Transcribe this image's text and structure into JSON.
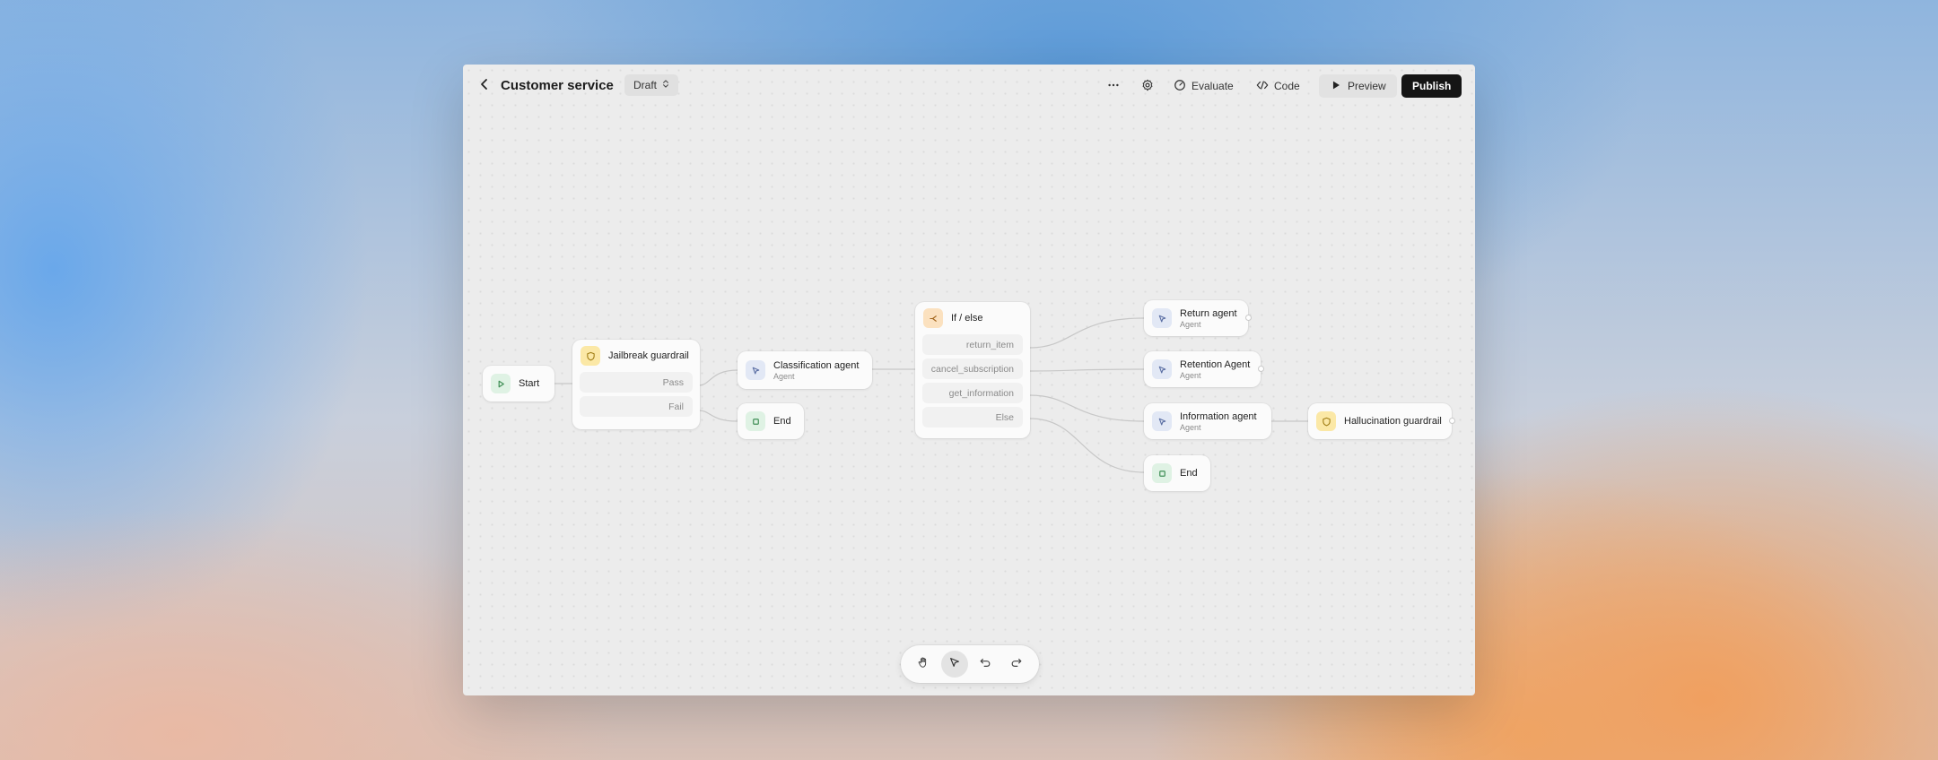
{
  "header": {
    "title": "Customer service",
    "status": "Draft",
    "evaluate_label": "Evaluate",
    "code_label": "Code",
    "preview_label": "Preview",
    "publish_label": "Publish"
  },
  "nodes": {
    "start": {
      "label": "Start",
      "icon": "play-icon"
    },
    "jailbreak": {
      "label": "Jailbreak guardrail",
      "icon": "shield-icon",
      "pass": "Pass",
      "fail": "Fail"
    },
    "classification": {
      "label": "Classification agent",
      "sub": "Agent",
      "icon": "cursor-icon"
    },
    "end1": {
      "label": "End",
      "icon": "stop-icon"
    },
    "ifelse": {
      "label": "If / else",
      "icon": "branch-icon",
      "branches": [
        "return_item",
        "cancel_subscription",
        "get_information",
        "Else"
      ]
    },
    "return_agent": {
      "label": "Return agent",
      "sub": "Agent"
    },
    "retention_agent": {
      "label": "Retention Agent",
      "sub": "Agent"
    },
    "information_agent": {
      "label": "Information agent",
      "sub": "Agent"
    },
    "end2": {
      "label": "End"
    },
    "hallucination": {
      "label": "Hallucination guardrail"
    }
  },
  "colors": {
    "publish_bg": "#151515",
    "start_icon_bg": "#dff2e4",
    "guardrail_icon_bg": "#fbe8a6",
    "agent_icon_bg": "#e2e8f5",
    "ifelse_icon_bg": "#fbe1bf"
  },
  "canvas_tools": [
    "hand-icon",
    "pointer-icon",
    "undo-icon",
    "redo-icon"
  ]
}
